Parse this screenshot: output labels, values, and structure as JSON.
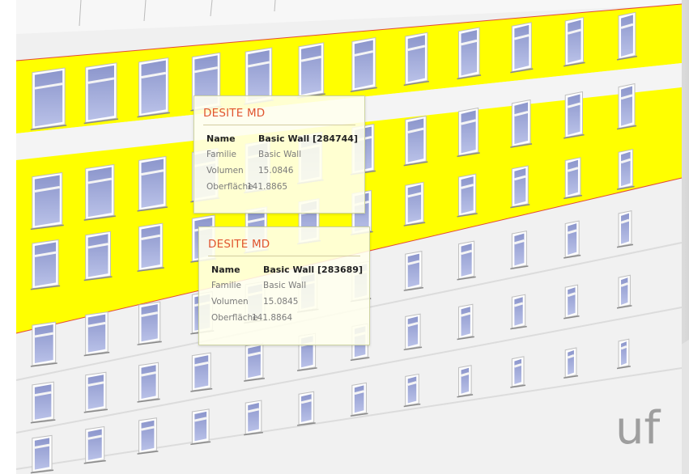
{
  "colors": {
    "highlight": "#ffff00",
    "wall": "#f2f2f2",
    "glass": "#aab4e0",
    "tooltip_title": "#e0542f"
  },
  "scene": {
    "watermark": "uf"
  },
  "tooltips": [
    {
      "title": "DESITE MD",
      "rows": [
        {
          "key": "Name",
          "value": "Basic Wall [284744]"
        },
        {
          "key": "Familie",
          "value": "Basic Wall"
        },
        {
          "key": "Volumen",
          "value": "15.0846"
        },
        {
          "key": "Oberfläche",
          "value": "141.8865"
        }
      ]
    },
    {
      "title": "DESITE MD",
      "rows": [
        {
          "key": "Name",
          "value": "Basic Wall [283689]"
        },
        {
          "key": "Familie",
          "value": "Basic Wall"
        },
        {
          "key": "Volumen",
          "value": "15.0845"
        },
        {
          "key": "Oberfläche",
          "value": "141.8864"
        }
      ]
    }
  ]
}
